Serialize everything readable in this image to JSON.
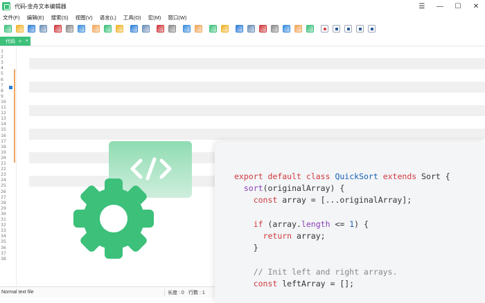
{
  "window": {
    "title": "代码-金舟文本编辑器",
    "controls": [
      "☰",
      "—",
      "☐",
      "✕"
    ]
  },
  "menu": [
    "文件(F)",
    "编辑(E)",
    "搜索(S)",
    "视图(V)",
    "语言(L)",
    "工具(O)",
    "宏(M)",
    "窗口(W)"
  ],
  "toolbar": {
    "groups": [
      [
        "new-file-icon",
        "open-folder-icon",
        "save-icon",
        "save-all-icon"
      ],
      [
        "close-icon",
        "close-all-icon",
        "print-icon"
      ],
      [
        "cut-icon",
        "copy-icon",
        "paste-icon"
      ],
      [
        "undo-icon",
        "redo-icon"
      ],
      [
        "find-icon",
        "replace-icon"
      ],
      [
        "zoom-in-icon",
        "zoom-out-icon"
      ],
      [
        "sync-vertical-icon",
        "sync-horizontal-icon"
      ],
      [
        "word-wrap-icon",
        "show-all-chars-icon",
        "indent-guide-icon",
        "doc-map-icon",
        "function-list-icon",
        "folder-workspace-icon",
        "monitor-icon"
      ],
      [
        "record-macro-icon",
        "stop-record-icon",
        "play-macro-icon",
        "run-macro-multiple-icon",
        "save-macro-icon"
      ]
    ],
    "colors": {
      "accent": "#3cc07a",
      "blue": "#2f7fd8",
      "red": "#d0393d",
      "orange": "#f2a65a"
    }
  },
  "tab": {
    "label": "代码",
    "pin": "✧",
    "close": "×"
  },
  "editor": {
    "line_numbers": [
      "1",
      "2",
      "3",
      "4",
      "5",
      "6",
      "7",
      "8",
      "9",
      "10",
      "11",
      "12",
      "13",
      "14",
      "15",
      "16",
      "17",
      "18",
      "19",
      "20",
      "21",
      "22",
      "23",
      "24",
      "25",
      "26",
      "27",
      "28",
      "29",
      "30",
      "31",
      "32",
      "33",
      "34",
      "35",
      "36",
      "37",
      "38"
    ]
  },
  "status": {
    "mode": "Normal text file",
    "length": "长度 : 0",
    "rows": "行数 : 1"
  },
  "overlay": {
    "code_symbol": "</>",
    "colors": {
      "gear": "#3cc07a",
      "badge": "#8fdcb2"
    }
  },
  "code_card": {
    "lines": [
      "export default class QuickSort extends Sort {",
      "  sort(originalArray) {",
      "    const array = [...originalArray];",
      "",
      "    if (array.length <= 1) {",
      "      return array;",
      "    }",
      "",
      "    // Init left and right arrays.",
      "    const leftArray = [];"
    ]
  }
}
